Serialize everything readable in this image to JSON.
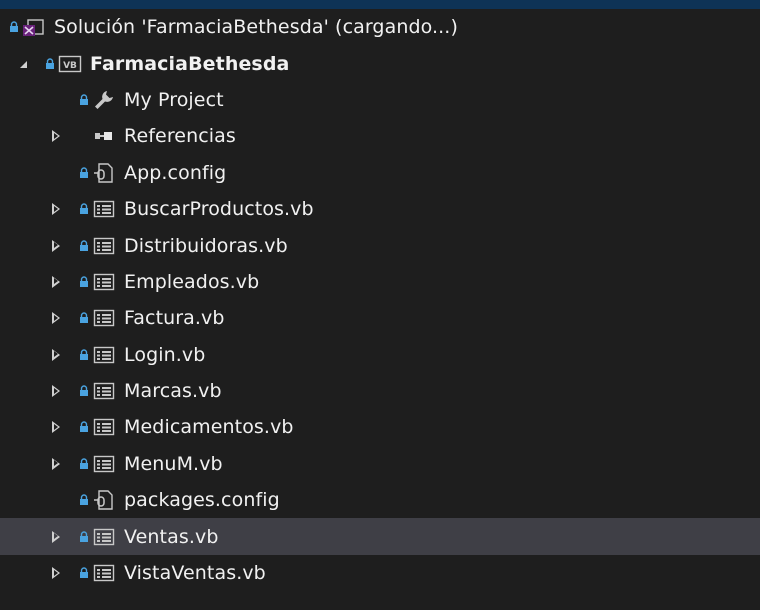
{
  "solution": {
    "label": "Solución 'FarmaciaBethesda'  (cargando...)",
    "icon": "solution-icon"
  },
  "project": {
    "label": "FarmaciaBethesda",
    "icon": "vb-project-icon",
    "expanded": true
  },
  "items": [
    {
      "label": "My Project",
      "icon": "wrench-icon",
      "expandable": false,
      "locked": true
    },
    {
      "label": "Referencias",
      "icon": "references-icon",
      "expandable": true,
      "locked": false
    },
    {
      "label": "App.config",
      "icon": "config-file-icon",
      "expandable": false,
      "locked": true
    },
    {
      "label": "BuscarProductos.vb",
      "icon": "form-icon",
      "expandable": true,
      "locked": true
    },
    {
      "label": "Distribuidoras.vb",
      "icon": "form-icon",
      "expandable": true,
      "locked": true
    },
    {
      "label": "Empleados.vb",
      "icon": "form-icon",
      "expandable": true,
      "locked": true
    },
    {
      "label": "Factura.vb",
      "icon": "form-icon",
      "expandable": true,
      "locked": true
    },
    {
      "label": "Login.vb",
      "icon": "form-icon",
      "expandable": true,
      "locked": true
    },
    {
      "label": "Marcas.vb",
      "icon": "form-icon",
      "expandable": true,
      "locked": true
    },
    {
      "label": "Medicamentos.vb",
      "icon": "form-icon",
      "expandable": true,
      "locked": true
    },
    {
      "label": "MenuM.vb",
      "icon": "form-icon",
      "expandable": true,
      "locked": true
    },
    {
      "label": "packages.config",
      "icon": "config-file-icon",
      "expandable": false,
      "locked": true
    },
    {
      "label": "Ventas.vb",
      "icon": "form-icon",
      "expandable": true,
      "locked": true
    },
    {
      "label": "VistaVentas.vb",
      "icon": "form-icon",
      "expandable": true,
      "locked": true
    }
  ],
  "selected_item": "Ventas.vb",
  "colors": {
    "background": "#1e1e1e",
    "selected_row": "#3f3f46",
    "text": "#f1f1f1",
    "lock": "#4aa3e0",
    "top_accent": "#0e3356"
  }
}
